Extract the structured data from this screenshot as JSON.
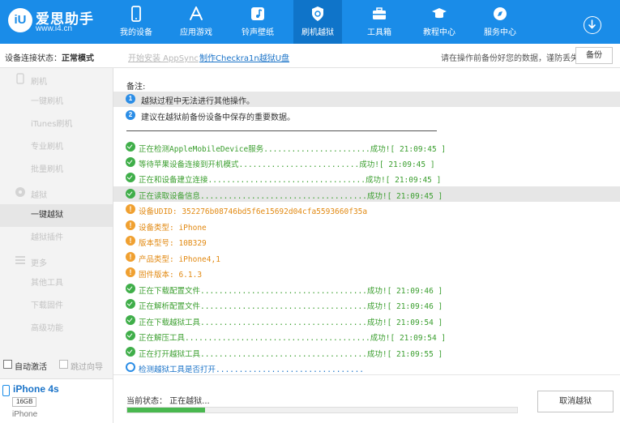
{
  "brand": {
    "mark": "iU",
    "name": "爱思助手",
    "url": "www.i4.cn"
  },
  "nav": [
    {
      "label": "我的设备",
      "icon": "phone-icon"
    },
    {
      "label": "应用游戏",
      "icon": "app-store-icon"
    },
    {
      "label": "铃声壁纸",
      "icon": "music-icon"
    },
    {
      "label": "刷机越狱",
      "icon": "flash-jailbreak-icon",
      "active": true
    },
    {
      "label": "工具箱",
      "icon": "toolbox-icon"
    },
    {
      "label": "教程中心",
      "icon": "tutorial-icon"
    },
    {
      "label": "服务中心",
      "icon": "service-icon"
    }
  ],
  "subheader": {
    "status_label": "设备连接状态：",
    "status_value": "正常模式",
    "link_install": "开始安装 AppSync",
    "link_checkra1n": "制作Checkra1n越狱U盘",
    "hint": "请在操作前备份好您的数据，谨防丢失",
    "backup_label": "备份"
  },
  "sidebar": {
    "groups": [
      {
        "label": "刷机",
        "icon": "flash-icon"
      },
      {
        "label": "越狱",
        "icon": "jailbreak-icon"
      },
      {
        "label": "更多",
        "icon": "more-icon"
      }
    ],
    "items": [
      "一键刷机",
      "iTunes刷机",
      "专业刷机",
      "批量刷机",
      "一键越狱",
      "越狱插件",
      "其他工具",
      "下载固件",
      "高级功能"
    ],
    "auto_activate": "自动激活",
    "skip_guide": "跳过向导"
  },
  "device": {
    "name": "iPhone 4s",
    "capacity": "16GB",
    "type": "iPhone"
  },
  "notes": {
    "title": "备注:",
    "items": [
      "越狱过程中无法进行其他操作。",
      "建议在越狱前备份设备中保存的重要数据。"
    ]
  },
  "log": [
    {
      "status": "ok",
      "text": "正在检测AppleMobileDevice服务.......................成功![ 21:09:45 ]"
    },
    {
      "status": "ok",
      "text": "等待苹果设备连接到开机模式..........................成功![ 21:09:45 ]"
    },
    {
      "status": "ok",
      "text": "正在和设备建立连接..................................成功![ 21:09:45 ]"
    },
    {
      "status": "ok",
      "text": "正在读取设备信息....................................成功![ 21:09:45 ]",
      "highlight": true
    },
    {
      "status": "warn",
      "text": "设备UDID: 352276b08746bd5f6e15692d04cfa5593660f35a"
    },
    {
      "status": "warn",
      "text": "设备类型: iPhone"
    },
    {
      "status": "warn",
      "text": "版本型号: 10B329"
    },
    {
      "status": "warn",
      "text": "产品类型: iPhone4,1"
    },
    {
      "status": "warn",
      "text": "固件版本: 6.1.3"
    },
    {
      "status": "ok",
      "text": "正在下载配置文件....................................成功![ 21:09:46 ]"
    },
    {
      "status": "ok",
      "text": "正在解析配置文件....................................成功![ 21:09:46 ]"
    },
    {
      "status": "ok",
      "text": "正在下载越狱工具....................................成功![ 21:09:54 ]"
    },
    {
      "status": "ok",
      "text": "正在解压工具........................................成功![ 21:09:54 ]"
    },
    {
      "status": "ok",
      "text": "正在打开越狱工具....................................成功![ 21:09:55 ]"
    },
    {
      "status": "info",
      "text": "检测越狱工具是否打开................................"
    }
  ],
  "footer": {
    "current_status": "当前状态： 正在越狱...",
    "progress": 0.2,
    "cancel_label": "取消越狱"
  }
}
